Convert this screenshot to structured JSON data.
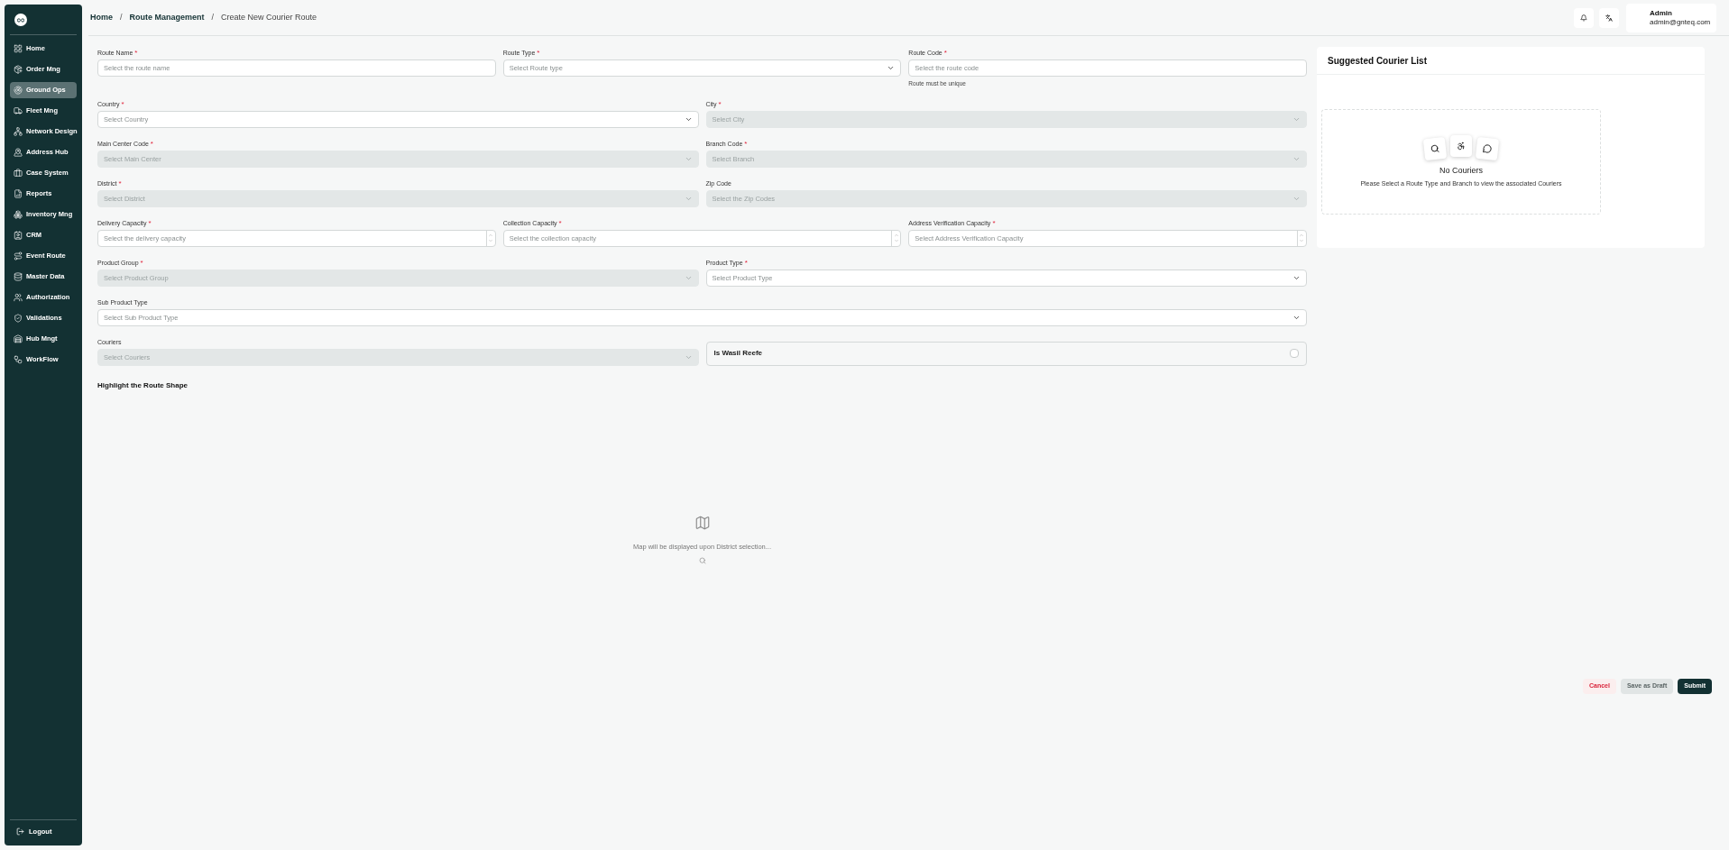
{
  "sidebar": {
    "items": [
      {
        "label": "Home",
        "selected": false
      },
      {
        "label": "Order Mng",
        "selected": false
      },
      {
        "label": "Ground Ops",
        "selected": true
      },
      {
        "label": "Fleet Mng",
        "selected": false
      },
      {
        "label": "Network Design",
        "selected": false
      },
      {
        "label": "Address Hub",
        "selected": false
      },
      {
        "label": "Case System",
        "selected": false
      },
      {
        "label": "Reports",
        "selected": false
      },
      {
        "label": "Inventory Mng",
        "selected": false
      },
      {
        "label": "CRM",
        "selected": false
      },
      {
        "label": "Event Route",
        "selected": false
      },
      {
        "label": "Master Data",
        "selected": false
      },
      {
        "label": "Authorization",
        "selected": false
      },
      {
        "label": "Validations",
        "selected": false
      },
      {
        "label": "Hub Mngt",
        "selected": false
      },
      {
        "label": "WorkFlow",
        "selected": false
      }
    ],
    "logout": "Logout"
  },
  "breadcrumbs": [
    {
      "kind": "link",
      "label": "Home"
    },
    {
      "kind": "separator",
      "label": "/"
    },
    {
      "kind": "link",
      "label": "Route Management"
    },
    {
      "kind": "separator",
      "label": "/"
    },
    {
      "kind": "current",
      "label": "Create New Courier Route"
    }
  ],
  "user": {
    "name": "Admin",
    "email": "admin@gnteq.com"
  },
  "form": {
    "rows": [
      {
        "fields": [
          {
            "kind": "text",
            "label": "Route Name",
            "required_mark": "*",
            "placeholder": "Select the route name",
            "disabled": false
          },
          {
            "kind": "select",
            "label": "Route Type",
            "required_mark": "*",
            "placeholder": "Select Route type",
            "disabled": false
          },
          {
            "kind": "text",
            "label": "Route Code",
            "required_mark": "*",
            "placeholder": "Select the route code",
            "disabled": false,
            "hint": "Route must be unique"
          }
        ]
      },
      {
        "fields": [
          {
            "kind": "select",
            "label": "Country",
            "required_mark": "*",
            "placeholder": "Select Country",
            "disabled": false
          },
          {
            "kind": "select",
            "label": "City",
            "required_mark": "*",
            "placeholder": "Select City",
            "disabled": true
          }
        ]
      },
      {
        "fields": [
          {
            "kind": "select",
            "label": "Main Center Code",
            "required_mark": "*",
            "placeholder": "Select Main Center",
            "disabled": true
          },
          {
            "kind": "select",
            "label": "Branch Code",
            "required_mark": "*",
            "placeholder": "Select Branch",
            "disabled": true
          }
        ]
      },
      {
        "fields": [
          {
            "kind": "select",
            "label": "District",
            "required_mark": "*",
            "placeholder": "Select District",
            "disabled": true
          },
          {
            "kind": "select",
            "label": "Zip Code",
            "placeholder": "Select the Zip Codes",
            "disabled": true
          }
        ]
      },
      {
        "fields": [
          {
            "kind": "number",
            "label": "Delivery Capacity",
            "required_mark": "*",
            "placeholder": "Select the delivery capacity",
            "disabled": false
          },
          {
            "kind": "number",
            "label": "Collection Capacity",
            "required_mark": "*",
            "placeholder": "Select the collection capacity",
            "disabled": false
          },
          {
            "kind": "number",
            "label": "Address Verification Capacity",
            "required_mark": "*",
            "placeholder": "Select Address Verification Capacity",
            "disabled": false
          }
        ]
      },
      {
        "fields": [
          {
            "kind": "select",
            "label": "Product Group",
            "required_mark": "*",
            "placeholder": "Select Product Group",
            "disabled": true
          },
          {
            "kind": "select",
            "label": "Product Type",
            "required_mark": "*",
            "placeholder": "Select Product Type",
            "disabled": false
          }
        ]
      },
      {
        "fields": [
          {
            "kind": "select",
            "label": "Sub Product Type",
            "placeholder": "Select Sub Product Type",
            "disabled": false
          }
        ]
      },
      {
        "fields": [
          {
            "kind": "select",
            "label": "Couriers",
            "placeholder": "Select Couriers",
            "disabled": true
          },
          {
            "kind": "checkbox",
            "label": "Is Wasil Reefe",
            "checked": false
          }
        ]
      }
    ]
  },
  "map": {
    "title": "Highlight the Route Shape",
    "message": "Map will be displayed upon District selection..."
  },
  "couriers": {
    "title": "Suggested Courier List",
    "empty_title": "No Couriers",
    "empty_text": "Please Select a Route Type and Branch to view the associated Couriers"
  },
  "actions": [
    {
      "kind": "cancel",
      "label": "Cancel"
    },
    {
      "kind": "draft",
      "label": "Save as Draft"
    },
    {
      "kind": "submit",
      "label": "Submit"
    }
  ]
}
